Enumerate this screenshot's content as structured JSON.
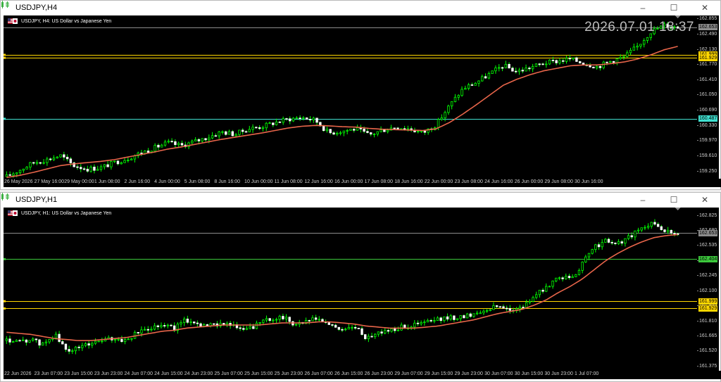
{
  "windows": [
    {
      "title": "USDJPY,H4",
      "symbol_label": "USDJPY, H4:  US Dollar vs Japanese Yen",
      "clock": "2026.07.01 18:37",
      "controls": [
        "–",
        "☐",
        "✕"
      ],
      "y_ticks": [
        "162.855",
        "162.490",
        "162.130",
        "161.770",
        "161.410",
        "161.050",
        "160.690",
        "160.330",
        "159.970",
        "159.610",
        "159.250"
      ],
      "price_badges": [
        {
          "label": "162.653",
          "color": "#8c8c8c"
        },
        {
          "label": "161.999",
          "color": "#ffd700"
        },
        {
          "label": "161.929",
          "color": "#ffd700"
        },
        {
          "label": "160.487",
          "color": "#40e0d0"
        }
      ],
      "x_ticks": [
        "26 May 2026",
        "27 May 16:00",
        "29 May 00:00",
        "1 Jun 08:00",
        "2 Jun 16:00",
        "4 Jun 00:00",
        "5 Jun 08:00",
        "8 Jun 16:00",
        "10 Jun 00:00",
        "11 Jun 08:00",
        "12 Jun 16:00",
        "16 Jun 00:00",
        "17 Jun 08:00",
        "18 Jun 16:00",
        "22 Jun 00:00",
        "23 Jun 08:00",
        "24 Jun 16:00",
        "26 Jun 00:00",
        "29 Jun 08:00",
        "30 Jun 16:00"
      ],
      "colors": {
        "candle": "#00ff00",
        "ma": "#e8654a",
        "gold": "#ffd700",
        "cyan": "#40e0d0",
        "grey": "#8c8c8c"
      }
    },
    {
      "title": "USDJPY,H1",
      "symbol_label": "USDJPY, H1:  US Dollar vs Japanese Yen",
      "controls": [
        "–",
        "☐",
        "✕"
      ],
      "y_ticks": [
        "162.825",
        "162.680",
        "162.535",
        "162.390",
        "162.245",
        "162.100",
        "161.955",
        "161.810",
        "161.665",
        "161.520",
        "161.375"
      ],
      "price_badges": [
        {
          "label": "162.653",
          "color": "#8c8c8c"
        },
        {
          "label": "162.404",
          "color": "#3cc83c"
        },
        {
          "label": "161.999",
          "color": "#ffd700"
        },
        {
          "label": "161.929",
          "color": "#ffd700"
        }
      ],
      "x_ticks": [
        "22 Jun 2026",
        "23 Jun 07:00",
        "23 Jun 15:00",
        "23 Jun 23:00",
        "24 Jun 07:00",
        "24 Jun 15:00",
        "24 Jun 23:00",
        "25 Jun 07:00",
        "25 Jun 15:00",
        "25 Jun 23:00",
        "26 Jun 07:00",
        "26 Jun 15:00",
        "26 Jun 23:00",
        "29 Jun 07:00",
        "29 Jun 15:00",
        "29 Jun 23:00",
        "30 Jun 07:00",
        "30 Jun 15:00",
        "30 Jun 23:00",
        "1 Jul 07:00"
      ],
      "colors": {
        "candle": "#00ff00",
        "ma": "#e8654a",
        "gold": "#ffd700",
        "green": "#3cc83c",
        "grey": "#8c8c8c"
      }
    }
  ],
  "chart_data": [
    {
      "type": "candlestick",
      "title": "USDJPY,H4",
      "ylim": [
        159.07,
        162.93
      ],
      "levels": [
        {
          "value": 162.653,
          "color": "#8c8c8c"
        },
        {
          "value": 161.999,
          "color": "#ffd700"
        },
        {
          "value": 161.929,
          "color": "#ffd700"
        },
        {
          "value": 160.487,
          "color": "#40e0d0"
        }
      ],
      "close_path": [
        159.12,
        159.28,
        159.45,
        159.52,
        159.62,
        159.38,
        159.3,
        159.33,
        159.45,
        159.55,
        159.68,
        159.8,
        159.92,
        159.85,
        159.95,
        160.05,
        160.18,
        160.12,
        160.25,
        160.3,
        160.4,
        160.48,
        160.52,
        160.45,
        160.15,
        160.2,
        160.25,
        160.1,
        160.22,
        160.3,
        160.25,
        160.15,
        160.35,
        160.8,
        161.2,
        161.35,
        161.55,
        161.75,
        161.6,
        161.7,
        161.8,
        161.85,
        161.9,
        161.8,
        161.72,
        161.85,
        161.95,
        162.2,
        162.55,
        162.7,
        162.65
      ],
      "ma_path": [
        159.1,
        159.15,
        159.22,
        159.3,
        159.38,
        159.42,
        159.45,
        159.48,
        159.52,
        159.58,
        159.64,
        159.7,
        159.77,
        159.82,
        159.88,
        159.94,
        160.0,
        160.05,
        160.1,
        160.15,
        160.21,
        160.27,
        160.31,
        160.33,
        160.32,
        160.3,
        160.29,
        160.26,
        160.24,
        160.23,
        160.22,
        160.21,
        160.25,
        160.4,
        160.6,
        160.82,
        161.05,
        161.28,
        161.42,
        161.53,
        161.62,
        161.68,
        161.74,
        161.76,
        161.76,
        161.79,
        161.83,
        161.9,
        162.0,
        162.12,
        162.2
      ]
    },
    {
      "type": "candlestick",
      "title": "USDJPY,H1",
      "ylim": [
        161.33,
        162.9
      ],
      "levels": [
        {
          "value": 162.653,
          "color": "#8c8c8c"
        },
        {
          "value": 162.404,
          "color": "#3cc83c"
        },
        {
          "value": 161.999,
          "color": "#ffd700"
        },
        {
          "value": 161.929,
          "color": "#ffd700"
        }
      ],
      "close_path": [
        161.62,
        161.6,
        161.63,
        161.58,
        161.68,
        161.52,
        161.55,
        161.6,
        161.62,
        161.64,
        161.62,
        161.7,
        161.75,
        161.78,
        161.74,
        161.82,
        161.78,
        161.76,
        161.8,
        161.75,
        161.72,
        161.78,
        161.83,
        161.85,
        161.78,
        161.8,
        161.83,
        161.76,
        161.73,
        161.75,
        161.65,
        161.7,
        161.72,
        161.75,
        161.77,
        161.8,
        161.82,
        161.84,
        161.85,
        161.88,
        161.92,
        161.95,
        161.92,
        161.93,
        162.05,
        162.12,
        162.25,
        162.2,
        162.35,
        162.52,
        162.58,
        162.55,
        162.62,
        162.7,
        162.75,
        162.68,
        162.62
      ],
      "ma_path": [
        161.7,
        161.69,
        161.68,
        161.66,
        161.64,
        161.63,
        161.62,
        161.62,
        161.63,
        161.64,
        161.65,
        161.67,
        161.69,
        161.71,
        161.72,
        161.74,
        161.75,
        161.76,
        161.77,
        161.77,
        161.77,
        161.77,
        161.78,
        161.79,
        161.79,
        161.79,
        161.8,
        161.8,
        161.79,
        161.78,
        161.76,
        161.75,
        161.74,
        161.74,
        161.74,
        161.75,
        161.76,
        161.78,
        161.8,
        161.82,
        161.85,
        161.88,
        161.9,
        161.92,
        161.96,
        162.01,
        162.08,
        162.14,
        162.21,
        162.3,
        162.39,
        162.46,
        162.52,
        162.57,
        162.61,
        162.63,
        162.64
      ]
    }
  ]
}
